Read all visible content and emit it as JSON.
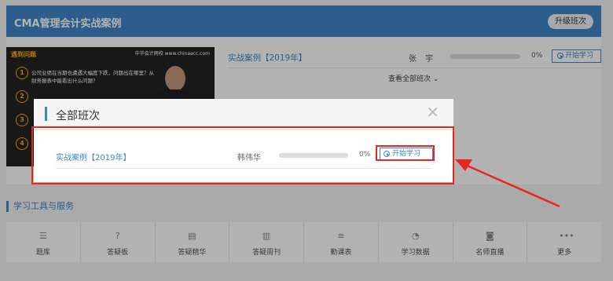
{
  "page": {
    "title": "CMA管理会计实战案例",
    "upgrade_label": "升级班次"
  },
  "video": {
    "top_label": "遇到问题",
    "brand": "中华会计网校 www.chinaacc.com",
    "question": "公司业绩在当期也遭遇大幅度下跌，问题出在哪里？从财务报表中能看出什么问题？",
    "numbers": [
      "1",
      "2",
      "3",
      "4"
    ]
  },
  "course_row": {
    "title": "实战案例【2019年】",
    "teacher": "张 宇",
    "progress_text": "0%",
    "progress": 0,
    "start_label": "开始学习"
  },
  "view_all_label": "查看全部班次 ⌄",
  "tools": {
    "heading": "学习工具与服务",
    "items": [
      {
        "label": "题库",
        "icon": "list-icon",
        "glyph": "☰"
      },
      {
        "label": "答疑板",
        "icon": "question-icon",
        "glyph": "?"
      },
      {
        "label": "答疑精华",
        "icon": "book-icon",
        "glyph": "▤"
      },
      {
        "label": "答疑周刊",
        "icon": "document-icon",
        "glyph": "▥"
      },
      {
        "label": "勤课表",
        "icon": "menu-icon",
        "glyph": "≡"
      },
      {
        "label": "学习数据",
        "icon": "chart-icon",
        "glyph": "◔"
      },
      {
        "label": "名师直播",
        "icon": "camera-icon",
        "glyph": "◙"
      },
      {
        "label": "更多",
        "icon": "more-icon",
        "glyph": "•••"
      }
    ]
  },
  "modal": {
    "title": "全部班次",
    "close_glyph": "✕",
    "course_title": "实战案例【2019年】",
    "teacher": "韩伟华",
    "progress_text": "0%",
    "progress": 0,
    "start_label": "开始学习"
  },
  "colors": {
    "brand_blue": "#3f86c9",
    "annotation_red": "#e8271c"
  }
}
